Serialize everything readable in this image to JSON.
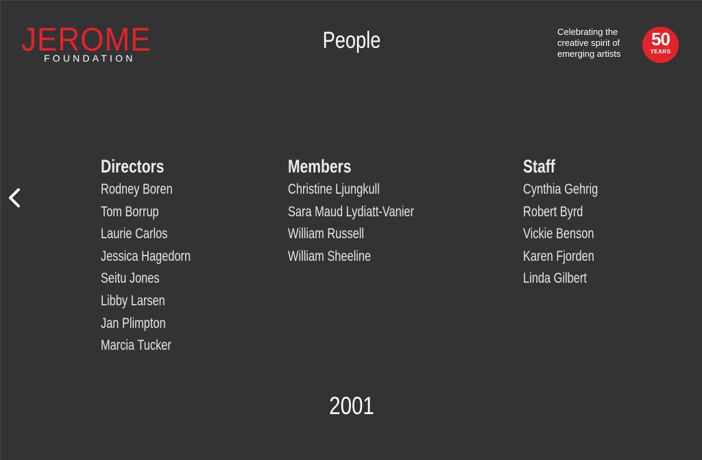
{
  "header": {
    "logo_word": "JEROME",
    "logo_sub": "FOUNDATION",
    "title": "People",
    "tagline": [
      "Celebrating the",
      "creative spirit of",
      "emerging artists"
    ],
    "badge_number": "50",
    "badge_label": "YEARS"
  },
  "navigation": {
    "prev_icon": "chevron-left-icon"
  },
  "columns": {
    "directors": {
      "heading": "Directors",
      "names": [
        "Rodney Boren",
        "Tom Borrup",
        "Laurie Carlos",
        "Jessica Hagedorn",
        "Seitu Jones",
        "Libby Larsen",
        "Jan Plimpton",
        "Marcia Tucker"
      ]
    },
    "members": {
      "heading": "Members",
      "names": [
        "Christine Ljungkull",
        "Sara Maud Lydiatt-Vanier",
        "William Russell",
        "William Sheeline"
      ]
    },
    "staff": {
      "heading": "Staff",
      "names": [
        "Cynthia Gehrig",
        "Robert Byrd",
        "Vickie Benson",
        "Karen Fjorden",
        "Linda Gilbert"
      ]
    }
  },
  "year": "2001",
  "colors": {
    "background": "#333333",
    "brand_red": "#e1232b",
    "text": "#f2f2f2"
  }
}
